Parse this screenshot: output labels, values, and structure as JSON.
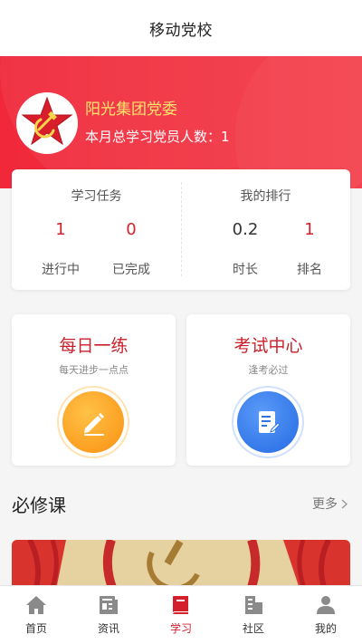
{
  "header": {
    "title": "移动党校"
  },
  "banner": {
    "org_name": "阳光集团党委",
    "member_count_text": "本月总学习党员人数：1"
  },
  "stats": {
    "tasks": {
      "title": "学习任务",
      "items": [
        {
          "value": "1",
          "label": "进行中"
        },
        {
          "value": "0",
          "label": "已完成"
        }
      ]
    },
    "ranking": {
      "title": "我的排行",
      "items": [
        {
          "value": "0.2",
          "label": "时长"
        },
        {
          "value": "1",
          "label": "排名"
        }
      ]
    }
  },
  "features": [
    {
      "title": "每日一练",
      "subtitle": "每天进步一点点",
      "icon": "pencil-icon"
    },
    {
      "title": "考试中心",
      "subtitle": "逢考必过",
      "icon": "exam-paper-icon"
    }
  ],
  "required_courses": {
    "title": "必修课",
    "more_label": "更多"
  },
  "tabbar": {
    "active_index": 2,
    "items": [
      {
        "label": "首页",
        "icon": "home-icon"
      },
      {
        "label": "资讯",
        "icon": "news-icon"
      },
      {
        "label": "学习",
        "icon": "book-icon"
      },
      {
        "label": "社区",
        "icon": "community-icon"
      },
      {
        "label": "我的",
        "icon": "user-icon"
      }
    ]
  },
  "colors": {
    "primary_red": "#f0283a",
    "accent_yellow": "#ffe46b",
    "orange": "#fb9a1c",
    "blue": "#2f74e8"
  }
}
